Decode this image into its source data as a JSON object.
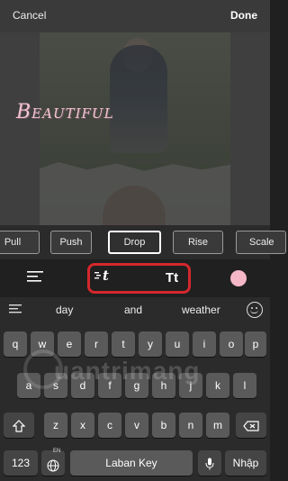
{
  "topbar": {
    "cancel_label": "Cancel",
    "done_label": "Done"
  },
  "canvas": {
    "overlay_text": "Beautiful",
    "text_color": "#f3c4d0"
  },
  "animation_options": [
    {
      "label": "Pull",
      "selected": false
    },
    {
      "label": "Push",
      "selected": false
    },
    {
      "label": "Drop",
      "selected": true
    },
    {
      "label": "Rise",
      "selected": false
    },
    {
      "label": "Scale",
      "selected": false
    }
  ],
  "tools": {
    "align_icon": "align-left-icon",
    "animation_icon": "text-animation-icon",
    "font_size_label": "Tt",
    "color_swatch": "#f5b7c7",
    "highlight_color": "#d4282d"
  },
  "keyboard": {
    "suggestions": [
      "day",
      "and",
      "weather"
    ],
    "row1": [
      "q",
      "w",
      "e",
      "r",
      "t",
      "y",
      "u",
      "i",
      "o",
      "p"
    ],
    "row2": [
      "a",
      "s",
      "d",
      "f",
      "g",
      "h",
      "j",
      "k",
      "l"
    ],
    "row3": [
      "z",
      "x",
      "c",
      "v",
      "b",
      "n",
      "m"
    ],
    "num_label": "123",
    "lang_label": "EN",
    "space_label": "Laban Key",
    "enter_label": "Nhập",
    "watermark": "uantrimang"
  }
}
